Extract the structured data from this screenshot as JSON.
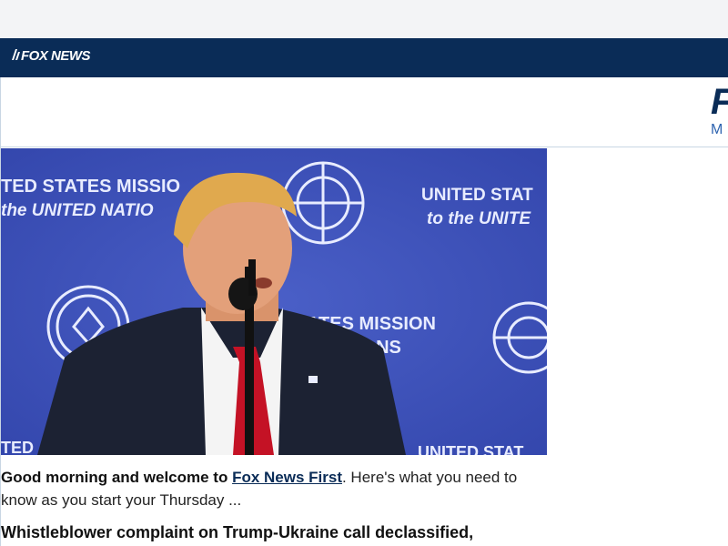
{
  "header": {
    "logo_text": "FOX NEWS",
    "brand_letter": "F",
    "brand_sub": "M"
  },
  "hero": {
    "backdrop_text": {
      "tl1": "TED STATES MISSIO",
      "tl2": "the UNITED NATIO",
      "tr1": "UNITED STAT",
      "tr2": "to the UNITE",
      "m1": "STATES MISSION",
      "m2": "ED NATIONS",
      "bl": "TED",
      "br": "UNITED STAT"
    },
    "colors": {
      "backdrop": "#3d51b8",
      "text": "#e8ecff"
    }
  },
  "article": {
    "intro_bold": "Good morning and welcome to ",
    "intro_link": "Fox News First",
    "intro_rest": ". Here's what you need to know as you start your Thursday ...",
    "headline": "Whistleblower complaint on Trump-Ukraine call declassified,"
  }
}
